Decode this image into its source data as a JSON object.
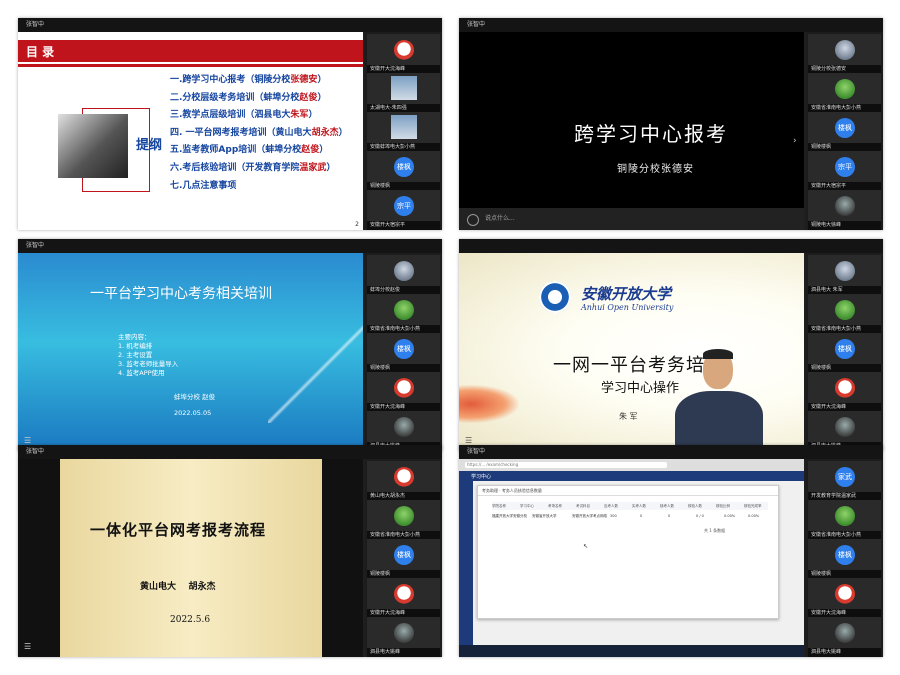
{
  "panels": [
    {
      "user": "张智中",
      "slide": {
        "header": "目 录",
        "label": "提纲",
        "toc": [
          {
            "pre": "一.跨学习中心报考（铜陵分校",
            "hl": "张德安",
            "post": "）"
          },
          {
            "pre": "二.分校层级考务培训（蚌埠分校",
            "hl": "赵俊",
            "post": "）"
          },
          {
            "pre": "三.教学点层级培训（泗县电大",
            "hl": "朱军",
            "post": "）"
          },
          {
            "pre": "四. 一平台网考报考培训（黄山电大",
            "hl": "胡永杰",
            "post": "）"
          },
          {
            "pre": "五.监考教师App培训（蚌埠分校",
            "hl": "赵俊",
            "post": "）"
          },
          {
            "pre": "六.考后核验培训（开发教育学院",
            "hl": "温家武",
            "post": "）"
          },
          {
            "pre": "七.几点注意事项",
            "hl": "",
            "post": ""
          }
        ],
        "page": "2"
      },
      "sidebar": [
        {
          "avatar": "cartoon",
          "name": "安徽开大沈海峰"
        },
        {
          "avatar": "building",
          "name": "太湖电大-朱四强"
        },
        {
          "avatar": "building",
          "name": "安徽蚌埠电大彭小燕"
        },
        {
          "avatar": "blue",
          "text": "楼枫",
          "name": "铜陵楼枫"
        },
        {
          "avatar": "blue",
          "text": "宗平",
          "name": "安徽开大宿宗平"
        }
      ]
    },
    {
      "user": "张智中",
      "slide": {
        "title": "跨学习中心报考",
        "subtitle": "铜陵分校张德安",
        "input_placeholder": "说点什么..."
      },
      "sidebar": [
        {
          "avatar": "person",
          "name": "铜陵分校张德安"
        },
        {
          "avatar": "green",
          "name": "安徽省淮南电大彭小燕"
        },
        {
          "avatar": "blue",
          "text": "楼枫",
          "name": "铜陵楼枫"
        },
        {
          "avatar": "blue",
          "text": "宗平",
          "name": "安徽开大宿宗平"
        },
        {
          "avatar": "dark",
          "name": "铜陵电大徐峰"
        }
      ]
    },
    {
      "user": "张智中",
      "slide": {
        "title": "一平台学习中心考务相关培训",
        "content": "主要内容：\n1. 机考编排\n2. 主考设置\n3. 监考老师批量导入\n4. 监考APP使用",
        "author": "蚌埠分校 赵俊",
        "date": "2022.05.05"
      },
      "sidebar": [
        {
          "avatar": "person",
          "name": "蚌埠分校赵俊"
        },
        {
          "avatar": "green",
          "name": "安徽省淮南电大彭小燕"
        },
        {
          "avatar": "blue",
          "text": "楼枫",
          "name": "铜陵楼枫"
        },
        {
          "avatar": "cartoon",
          "name": "安徽开大沈海峰"
        },
        {
          "avatar": "dark",
          "name": "泗县电大姚峰"
        }
      ]
    },
    {
      "user": "",
      "slide": {
        "univ_cn": "安徽开放大学",
        "univ_en": "Anhui Open University",
        "title": "一网一平台考务培训",
        "subtitle": "学习中心操作",
        "speaker": "朱 军"
      },
      "sidebar": [
        {
          "avatar": "person",
          "name": "泗县电大 朱军"
        },
        {
          "avatar": "green",
          "name": "安徽省淮南电大彭小燕"
        },
        {
          "avatar": "blue",
          "text": "楼枫",
          "name": "铜陵楼枫"
        },
        {
          "avatar": "cartoon",
          "name": "安徽开大沈海峰"
        },
        {
          "avatar": "dark",
          "name": "泗县电大姚峰"
        }
      ]
    },
    {
      "user": "张智中",
      "slide": {
        "title": "一体化平台网考报考流程",
        "author": "黄山电大    胡永杰",
        "date": "2022.5.6"
      },
      "sidebar": [
        {
          "avatar": "cartoon",
          "name": "黄山电大胡永杰"
        },
        {
          "avatar": "green",
          "name": "安徽省淮南电大彭小燕"
        },
        {
          "avatar": "blue",
          "text": "楼枫",
          "name": "铜陵楼枫"
        },
        {
          "avatar": "cartoon",
          "name": "安徽开大沈海峰"
        },
        {
          "avatar": "dark",
          "name": "泗县电大姚峰"
        }
      ]
    },
    {
      "user": "张智中",
      "slide": {
        "url": "https://... /exam/checking",
        "app_title": "学习中心",
        "dialog_title": "考务助理 · 考务人员核验信息数量",
        "headers": [
          "学院名称",
          "学习中心",
          "考场名称",
          "考试科目",
          "应考人数",
          "实考人数",
          "缺考人数",
          "核验人数",
          "核验比例",
          "核验完成率"
        ],
        "row": [
          "福建开放大学安徽分校",
          "安徽省开放大学",
          "安徽开放大学考点网络",
          "300",
          "0",
          "0",
          "0 / 0",
          "0.00%",
          "0.00%"
        ],
        "pager": "共 1 条数据"
      },
      "sidebar": [
        {
          "avatar": "blue",
          "text": "家武",
          "name": "开发教育学院温家武"
        },
        {
          "avatar": "green",
          "name": "安徽省淮南电大彭小燕"
        },
        {
          "avatar": "blue",
          "text": "楼枫",
          "name": "铜陵楼枫"
        },
        {
          "avatar": "cartoon",
          "name": "安徽开大沈海峰"
        },
        {
          "avatar": "dark",
          "name": "泗县电大姚峰"
        }
      ]
    }
  ]
}
